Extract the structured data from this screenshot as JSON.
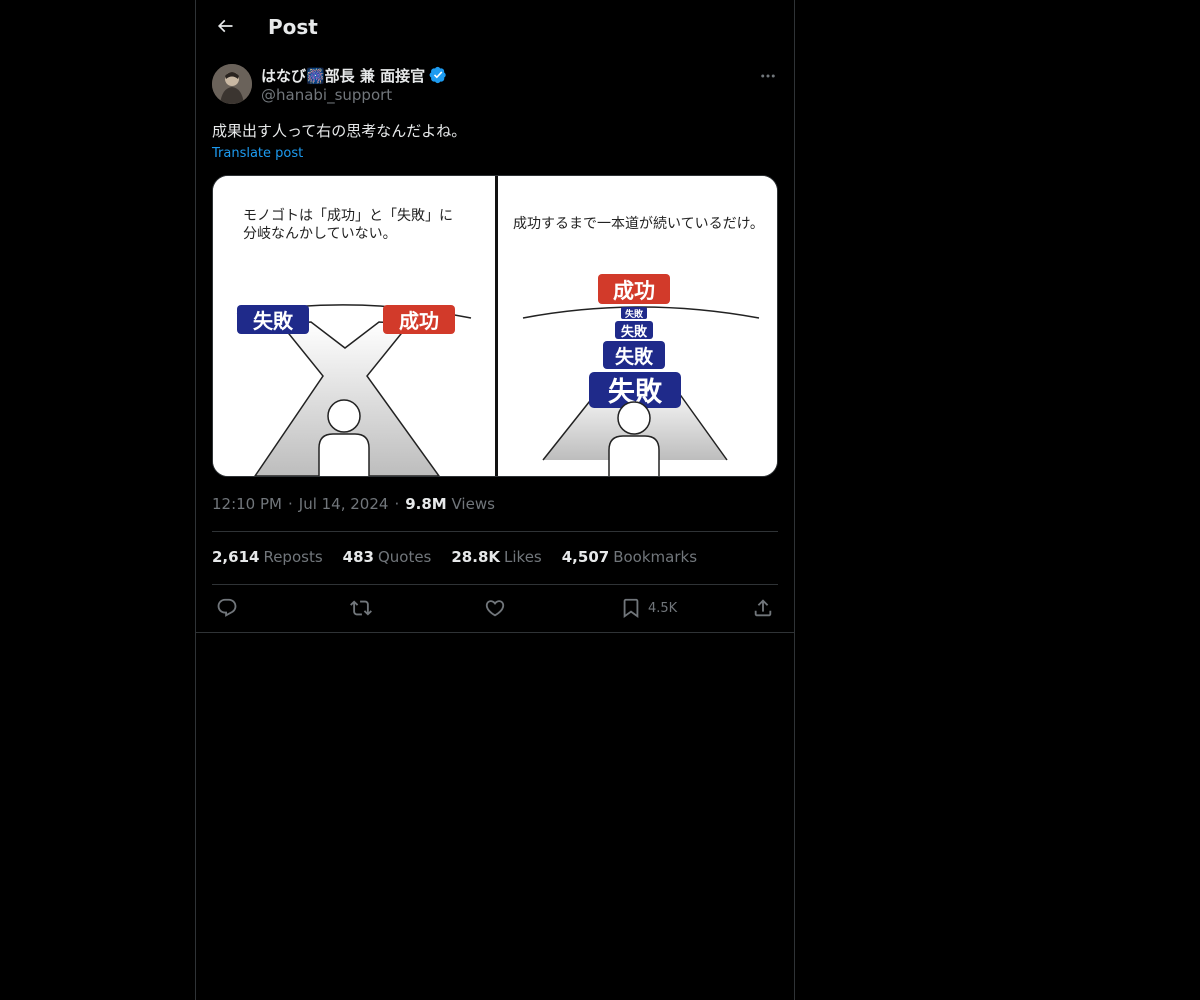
{
  "header": {
    "title": "Post"
  },
  "author": {
    "display_name": "はなび🎆部長 兼 面接官",
    "handle": "@hanabi_support",
    "verified_color": "#1d9bf0"
  },
  "post": {
    "text": "成果出す人って右の思考なんだよね。",
    "translate_label": "Translate post"
  },
  "media": {
    "left_caption_line1": "モノゴトは「成功」と「失敗」に",
    "left_caption_line2": "分岐なんかしていない。",
    "right_caption": "成功するまで一本道が続いているだけ。",
    "fail_label": "失敗",
    "success_label": "成功",
    "fail_color": "#1f2a8a",
    "success_color": "#d23a2a"
  },
  "meta": {
    "time": "12:10 PM",
    "date": "Jul 14, 2024",
    "views_count": "9.8M",
    "views_label": "Views",
    "separator": "·"
  },
  "stats": {
    "reposts": {
      "num": "2,614",
      "label": "Reposts"
    },
    "quotes": {
      "num": "483",
      "label": "Quotes"
    },
    "likes": {
      "num": "28.8K",
      "label": "Likes"
    },
    "bookmarks": {
      "num": "4,507",
      "label": "Bookmarks"
    }
  },
  "actions": {
    "bookmark_count": "4.5K"
  },
  "icons": {
    "back": "arrow-left-icon",
    "more": "more-horizontal-icon",
    "verified": "verified-badge-icon",
    "reply": "reply-icon",
    "repost": "repost-icon",
    "like": "heart-icon",
    "bookmark": "bookmark-icon",
    "share": "share-icon"
  }
}
